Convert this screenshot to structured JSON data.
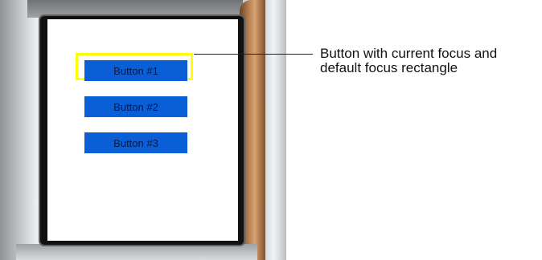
{
  "buttons": [
    {
      "label": "Button #1",
      "focused": true
    },
    {
      "label": "Button #2",
      "focused": false
    },
    {
      "label": "Button #3",
      "focused": false
    }
  ],
  "annotation": {
    "line1": "Button with current focus and",
    "line2": "default focus rectangle"
  },
  "colors": {
    "button_fill": "#0a5ed6",
    "focus_rectangle": "#ffff00",
    "screen_background": "#ffffff"
  }
}
